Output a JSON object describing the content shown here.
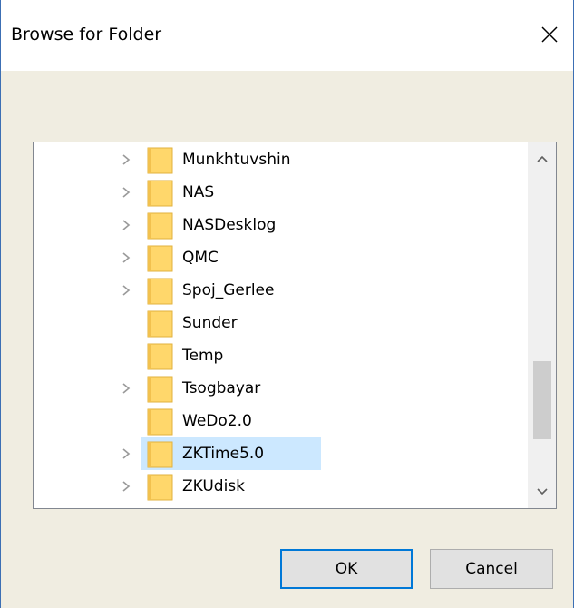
{
  "dialog": {
    "title": "Browse for Folder",
    "close_icon": "close-icon"
  },
  "tree": {
    "items": [
      {
        "label": "Munkhtuvshin",
        "expandable": true,
        "selected": false
      },
      {
        "label": "NAS",
        "expandable": true,
        "selected": false
      },
      {
        "label": "NASDesklog",
        "expandable": true,
        "selected": false
      },
      {
        "label": "QMC",
        "expandable": true,
        "selected": false
      },
      {
        "label": "Spoj_Gerlee",
        "expandable": true,
        "selected": false
      },
      {
        "label": "Sunder",
        "expandable": false,
        "selected": false
      },
      {
        "label": "Temp",
        "expandable": false,
        "selected": false
      },
      {
        "label": "Tsogbayar",
        "expandable": true,
        "selected": false
      },
      {
        "label": "WeDo2.0",
        "expandable": false,
        "selected": false
      },
      {
        "label": "ZKTime5.0",
        "expandable": true,
        "selected": true
      },
      {
        "label": "ZKUdisk",
        "expandable": true,
        "selected": false
      }
    ]
  },
  "buttons": {
    "ok_label": "OK",
    "cancel_label": "Cancel"
  },
  "colors": {
    "dialog_bg": "#f0ede1",
    "selection": "#cce8ff",
    "folder_fill": "#ffd76b",
    "focus_border": "#0078d7"
  }
}
